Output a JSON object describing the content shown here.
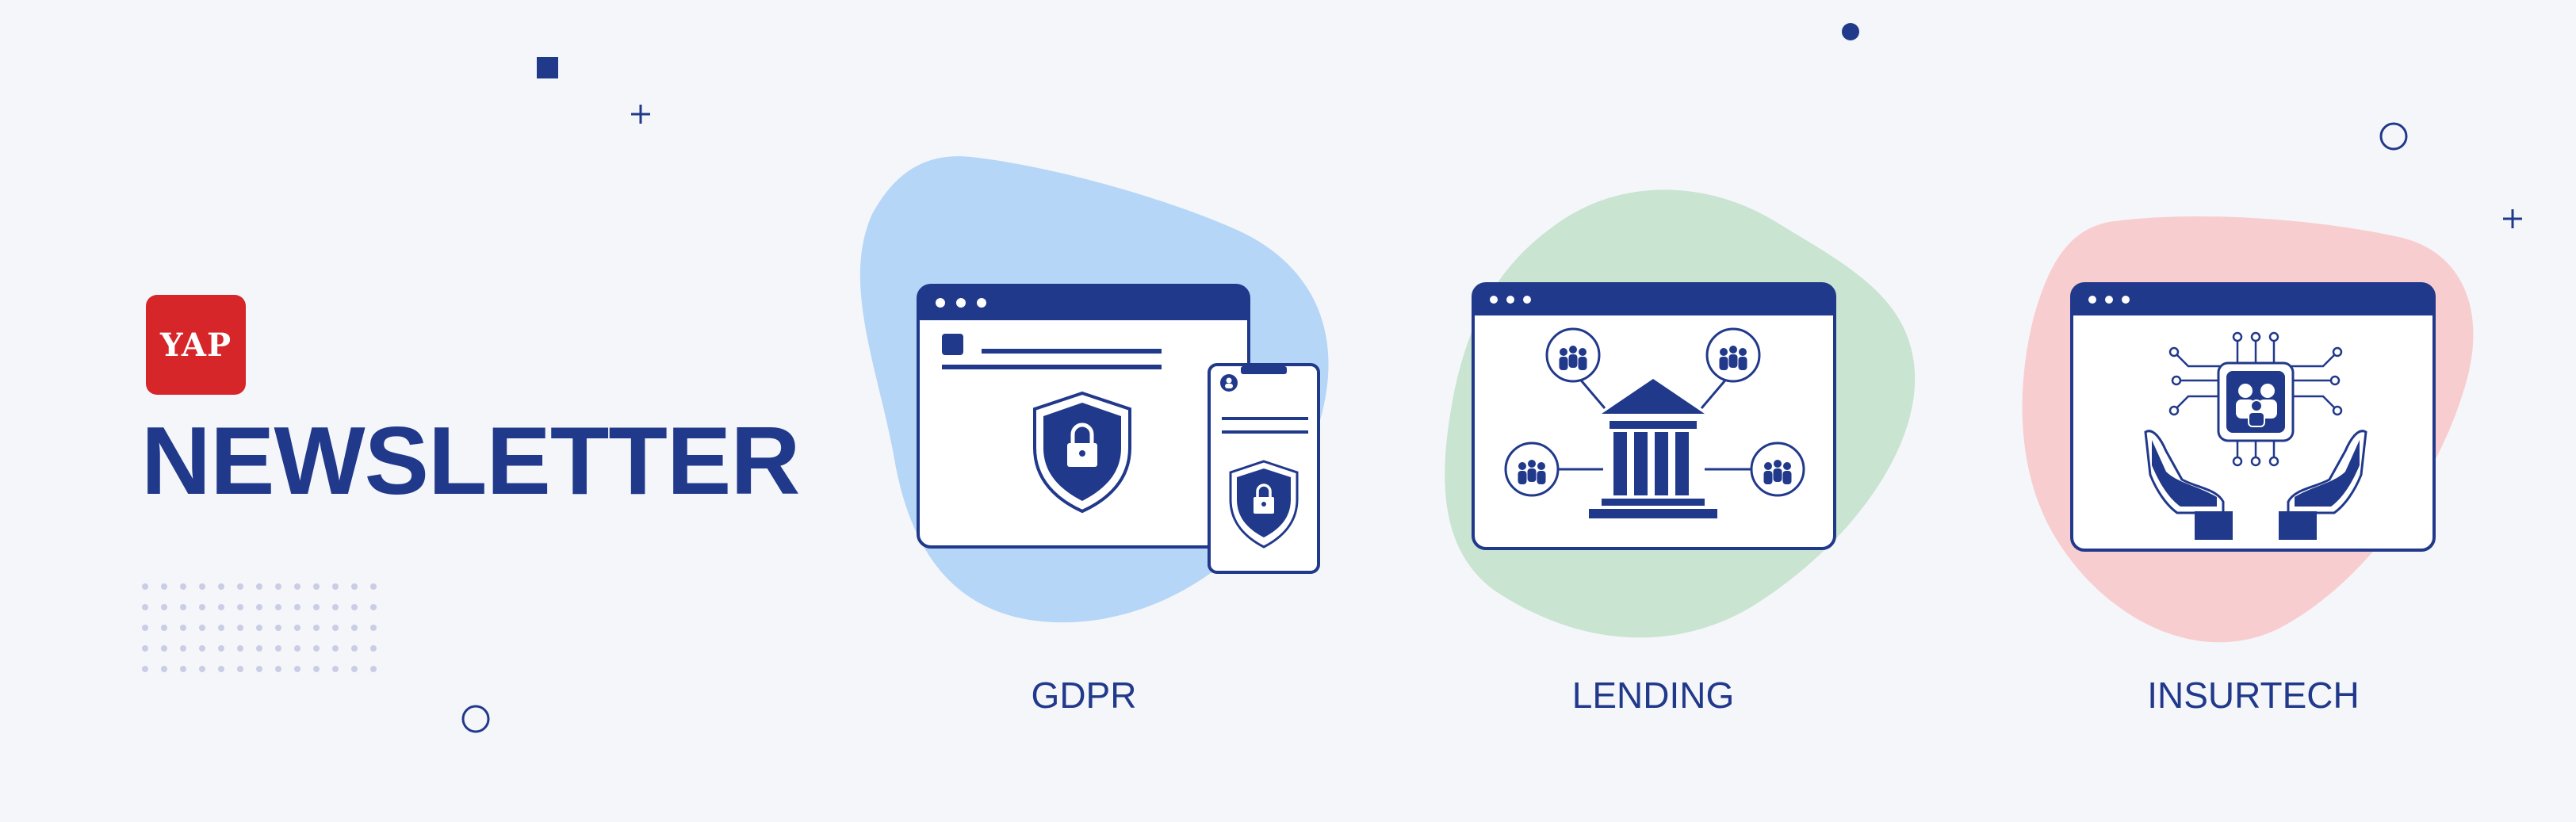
{
  "brand": {
    "logo_text": "YAP",
    "title": "NEWSLETTER"
  },
  "colors": {
    "background": "#f5f6fa",
    "primary_navy": "#21398b",
    "logo_red": "#d6262a",
    "blob_blue": "#b5d6f7",
    "blob_green": "#c9e4d1",
    "blob_pink": "#f8cdd0",
    "dot_grid": "#c9cde6"
  },
  "topics": [
    {
      "label": "GDPR",
      "illustration": "browser-window-and-phone-with-shield-lock-icons"
    },
    {
      "label": "LENDING",
      "illustration": "browser-window-with-bank-building-and-people-groups-icons"
    },
    {
      "label": "INSURTECH",
      "illustration": "browser-window-with-hands-holding-circuit-family-icon"
    }
  ]
}
